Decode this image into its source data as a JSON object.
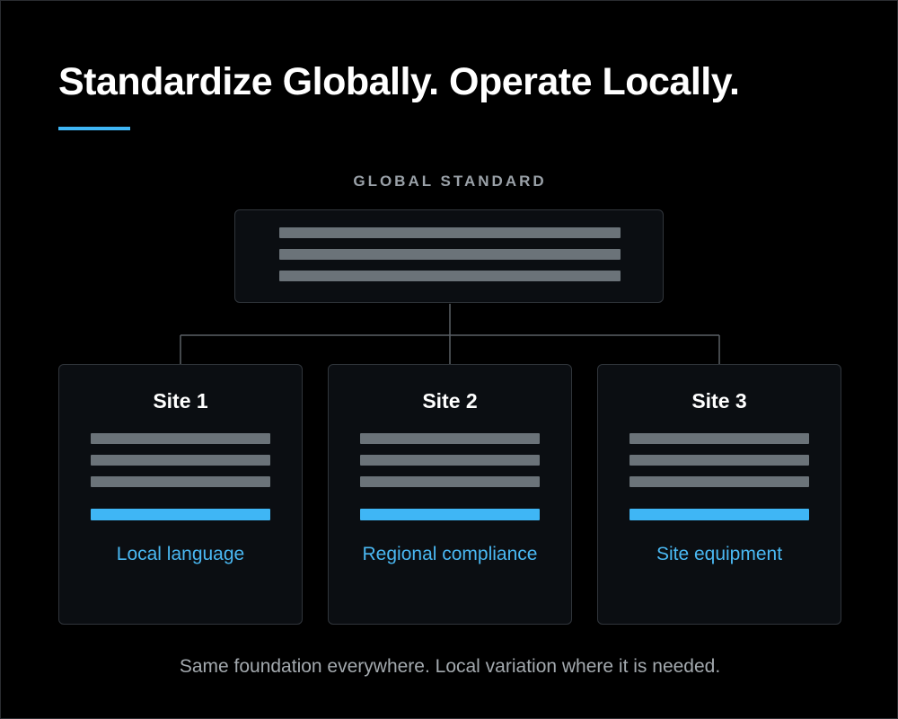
{
  "title": "Standardize Globally. Operate Locally.",
  "global": {
    "label": "GLOBAL STANDARD"
  },
  "sites": [
    {
      "name": "Site 1",
      "variation": "Local language"
    },
    {
      "name": "Site 2",
      "variation": "Regional compliance"
    },
    {
      "name": "Site 3",
      "variation": "Site equipment"
    }
  ],
  "footer": "Same foundation everywhere. Local variation where it is needed.",
  "colors": {
    "background": "#000000",
    "accent": "#3fb6f5",
    "card": "#0b0e12",
    "placeholder_bar": "#6b7379"
  }
}
